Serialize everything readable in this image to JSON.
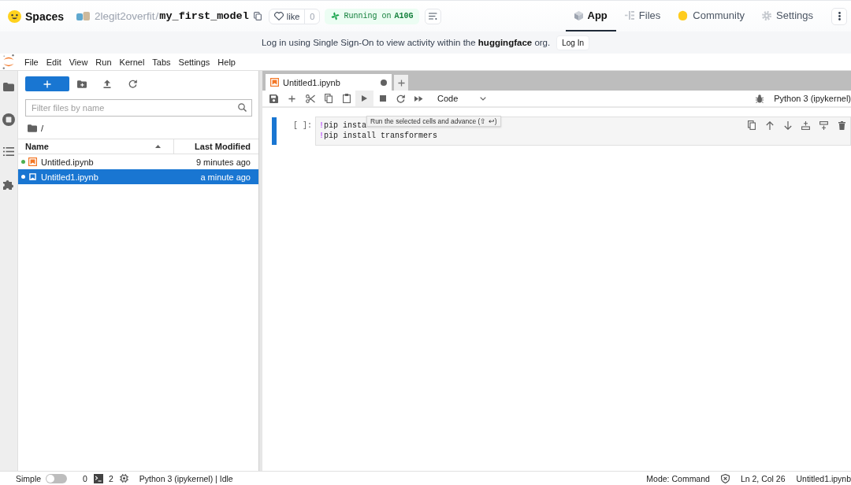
{
  "header": {
    "title": "Spaces",
    "owner": "2legit2overfit",
    "separator": "/",
    "repo": "my_first_model",
    "like": {
      "label": "like",
      "count": "0"
    },
    "status": {
      "label": "Running on",
      "hardware": "A10G"
    },
    "tabs": [
      {
        "label": "App",
        "selected": true
      },
      {
        "label": "Files",
        "selected": false
      },
      {
        "label": "Community",
        "selected": false
      },
      {
        "label": "Settings",
        "selected": false
      }
    ]
  },
  "banner": {
    "message": "Log in using Single Sign-On to view activity within the **huggingface** org.",
    "button": "Log In"
  },
  "menu": [
    "File",
    "Edit",
    "View",
    "Run",
    "Kernel",
    "Tabs",
    "Settings",
    "Help"
  ],
  "file_browser": {
    "filter_placeholder": "Filter files by name",
    "path": "/",
    "columns": [
      {
        "label": "Name",
        "sorted": true
      },
      {
        "label": "Last Modified",
        "sorted": false
      }
    ],
    "files": [
      {
        "name": "Untitled.ipynb",
        "modified": "9 minutes ago",
        "running": true,
        "selected": false
      },
      {
        "name": "Untitled1.ipynb",
        "modified": "a minute ago",
        "running": true,
        "selected": true
      }
    ]
  },
  "notebook": {
    "tabs": [
      {
        "label": "Untitled1.ipynb",
        "selected": true,
        "modified": true
      }
    ],
    "cell_type": "Code",
    "kernel": "Python 3 (ipykernel)",
    "cells": [
      {
        "prompt": "[ ]:",
        "active": true,
        "lines": [
          {
            "magic": "!",
            "code": "pip insta"
          },
          {
            "magic": "!",
            "code": "pip install transformers"
          }
        ]
      }
    ],
    "tooltip": "Run the selected cells and advance (⇧ ↩)"
  },
  "status_bar": {
    "mode_label": "Simple",
    "simple_mode": false,
    "terminals": "0",
    "kernels": "2",
    "kernel_status": "Python 3 (ipykernel) | Idle",
    "mode": "Mode: Command",
    "cursor": "Ln 2, Col 26",
    "file": "Untitled1.ipynb"
  }
}
